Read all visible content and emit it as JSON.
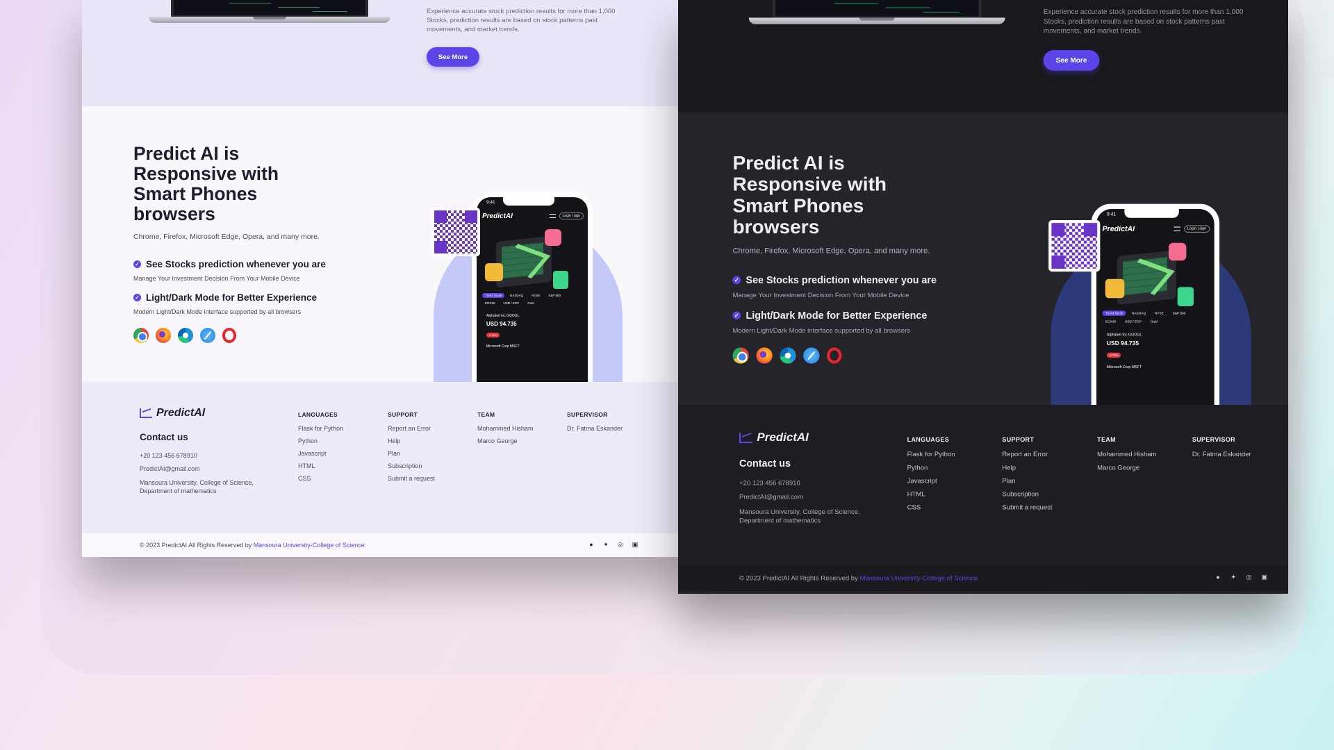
{
  "top": {
    "description": "Experience accurate stock prediction results for more than 1,000 Stocks, prediction results are based on stock patterns past movements, and market trends.",
    "see_more": "See More"
  },
  "responsive": {
    "title": "Predict AI is Responsive with Smart Phones browsers",
    "subtitle": "Chrome, Firefox, Microsoft Edge, Opera, and many more.",
    "feature1_title": "See Stocks prediction whenever you are",
    "feature1_desc": "Manage Your Investment Decision From Your Mobile Device",
    "feature2_title": "Light/Dark Mode for Better Experience",
    "feature2_desc": "Modern Light/Dark Mode interface supported by all browsers",
    "browsers": [
      "chrome-icon",
      "firefox-icon",
      "edge-icon",
      "safari-icon",
      "opera-icon"
    ]
  },
  "phone": {
    "time": "9:41",
    "logo": "PredictAI",
    "login": "Login | sign",
    "tabs": [
      "Trend Stock",
      "NASDAQ",
      "NYSE",
      "S&P 500",
      "EGX30",
      "USD / EGP",
      "Gold"
    ],
    "stock_name": "Alphabet Inc  GOOGL",
    "stock_value": "USD 94.735",
    "stock_change": "-0.76%",
    "stock2": "Microsoft Corp  MSFT"
  },
  "footer": {
    "logo": "PredictAI",
    "contact_title": "Contact us",
    "phone": "+20 123 456 678910",
    "email": "PredictAI@gmail.com",
    "address": "Mansoura University, College of Science, Department of mathematics",
    "columns": [
      {
        "title": "LANGUAGES",
        "items": [
          "Flask for Python",
          "Python",
          "Javascript",
          "HTML",
          "CSS"
        ]
      },
      {
        "title": "SUPPORT",
        "items": [
          "Report an Error",
          "Help",
          "Plan",
          "Subscription",
          "Submit a request"
        ]
      },
      {
        "title": "TEAM",
        "items": [
          "Mohammed Hisham",
          "Marco George"
        ]
      },
      {
        "title": "SUPERVISOR",
        "items": [
          "Dr. Fatma Eskander"
        ]
      }
    ],
    "copyright": "© 2023 PredictAI All Rights Reserved by ",
    "copyright_link": "Mansoura University-College of Science",
    "social": [
      "facebook-icon",
      "twitter-icon",
      "instagram-icon",
      "linkedin-icon"
    ]
  },
  "colors": {
    "accent": "#5b44e8",
    "dark_bg": "#1e1d22",
    "light_bg": "#edebf8"
  }
}
